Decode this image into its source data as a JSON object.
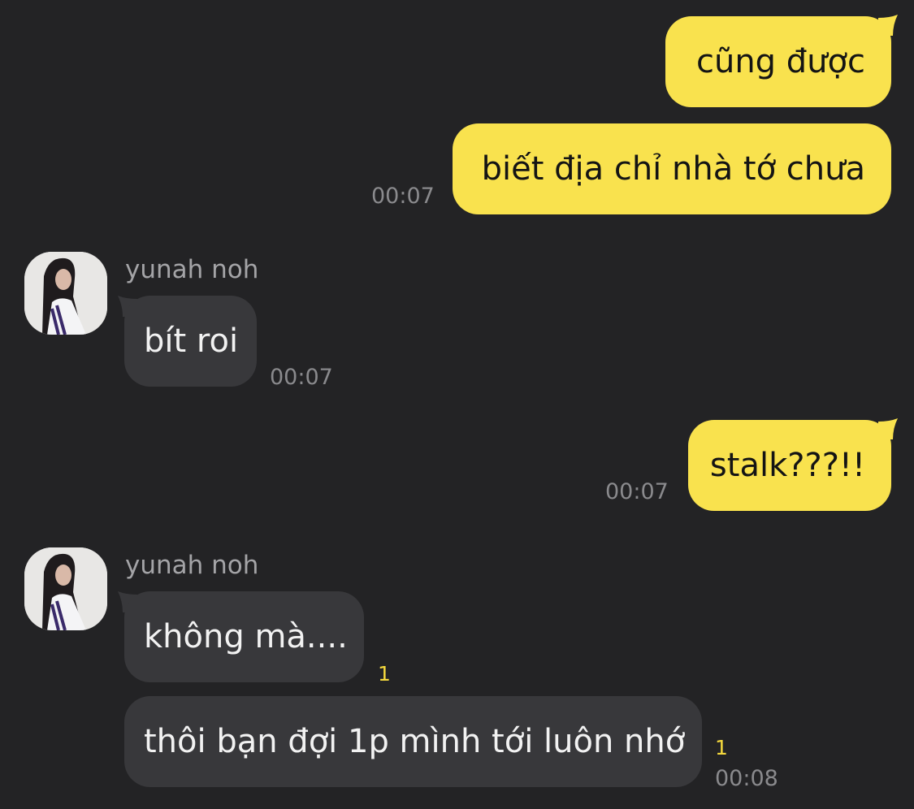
{
  "colors": {
    "background": "#232325",
    "outgoing_bubble": "#f9e24e",
    "incoming_bubble": "#38383b",
    "timestamp": "#8a8a8d",
    "unread_count": "#f5d93d"
  },
  "messages": [
    {
      "direction": "out",
      "text": "cũng được"
    },
    {
      "direction": "out",
      "text": "biết địa chỉ nhà tớ chưa",
      "time": "00:07"
    },
    {
      "direction": "in",
      "sender": "yunah noh",
      "text": "bít roi",
      "time": "00:07"
    },
    {
      "direction": "out",
      "text": "stalk???!!",
      "time": "00:07"
    },
    {
      "direction": "in",
      "sender": "yunah noh",
      "text": "không mà....",
      "unread": "1"
    },
    {
      "direction": "in",
      "text": "thôi bạn đợi 1p mình tới luôn nhớ",
      "unread": "1",
      "time": "00:08"
    }
  ],
  "avatar": {
    "icon": "profile-photo-icon"
  }
}
